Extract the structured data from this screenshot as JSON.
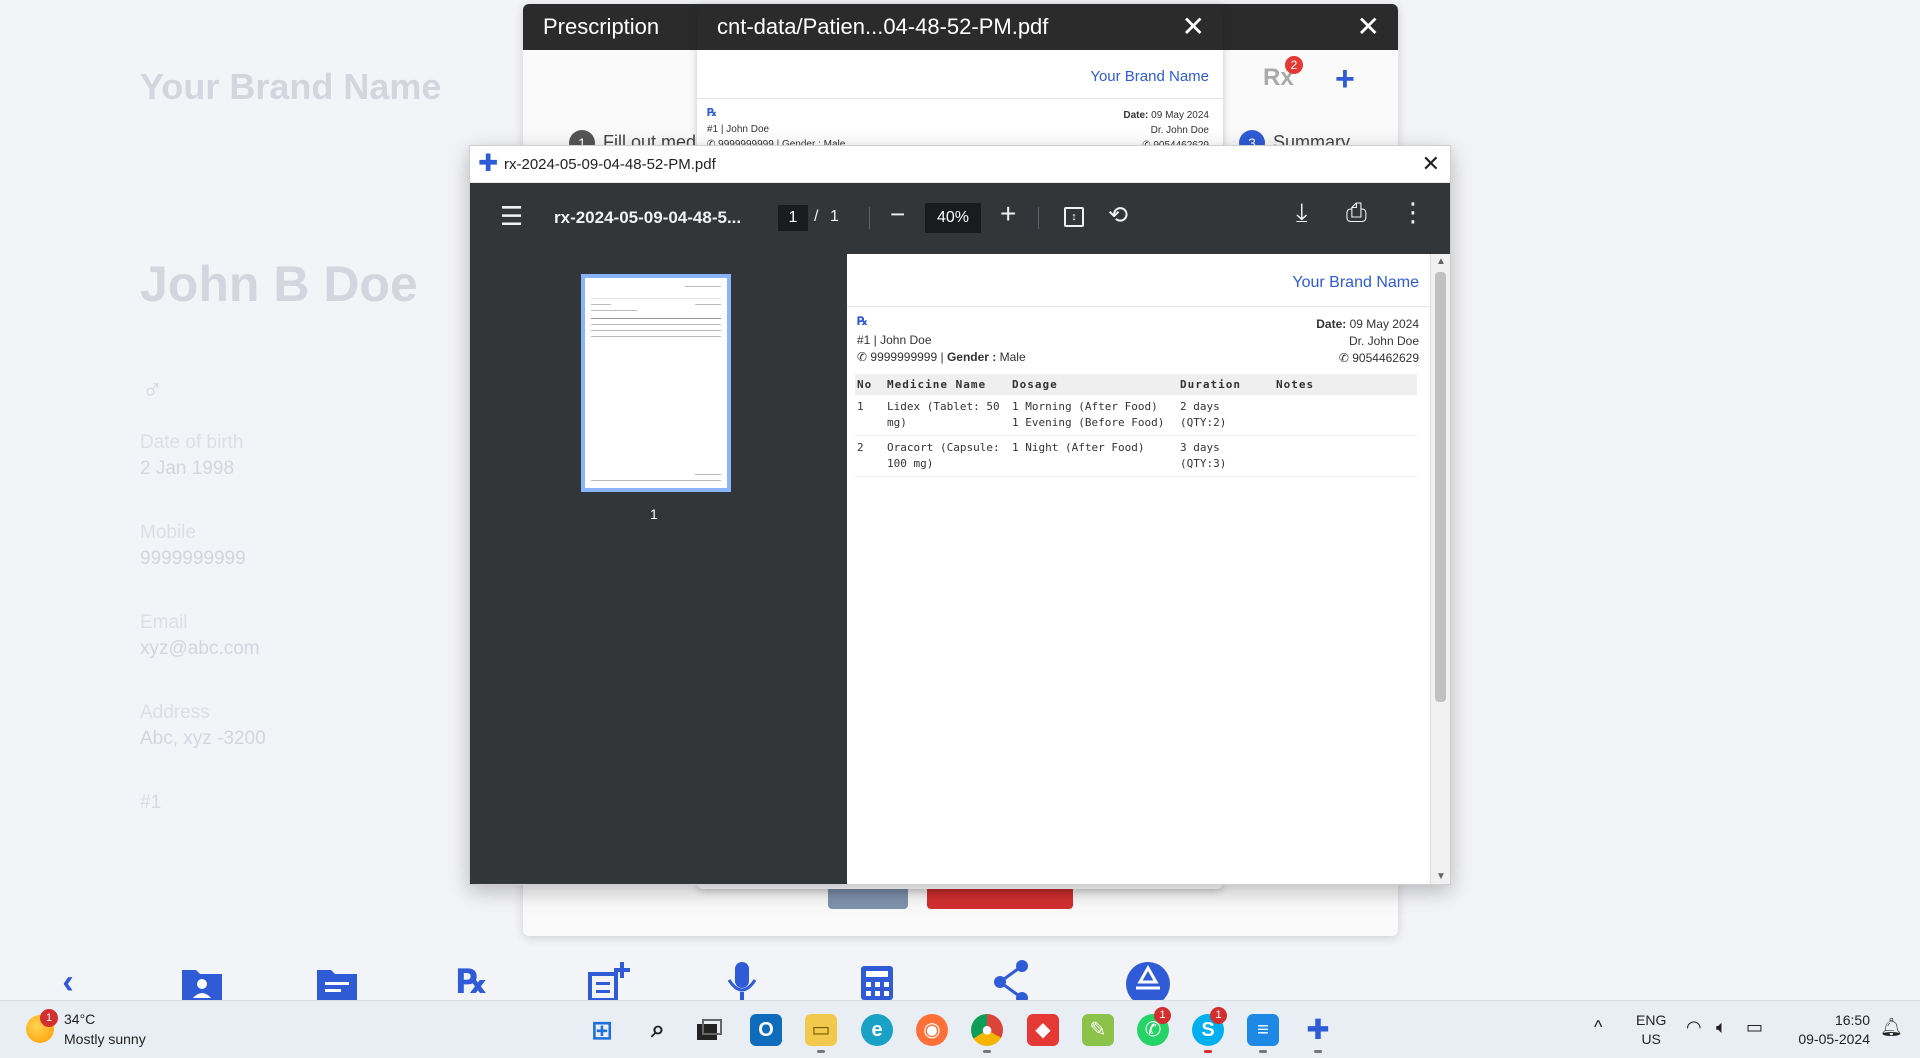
{
  "background": {
    "brand": "Your Brand Name",
    "patient_name": "John B Doe",
    "gender_symbol": "♂",
    "fields": [
      {
        "label": "Date of birth",
        "value": "2 Jan 1998"
      },
      {
        "label": "Mobile",
        "value": "9999999999"
      },
      {
        "label": "Email",
        "value": "xyz@abc.com"
      },
      {
        "label": "Address",
        "value": "Abc, xyz -3200"
      }
    ],
    "patient_id": "#1",
    "bottom_nav_icons": [
      "back-chevron-icon",
      "patient-folder-icon",
      "notes-icon",
      "rx-icon",
      "add-note-icon",
      "microphone-icon",
      "calculator-icon",
      "share-icon",
      "camera-shutter-icon"
    ]
  },
  "prescription_modal": {
    "title": "Prescription",
    "close": "✕",
    "rx_label": "Rx",
    "rx_badge": "2",
    "add": "+",
    "step1_num": "1",
    "step1_label": "Fill out med",
    "step3_num": "3",
    "step3_label": "Summary"
  },
  "pdf_back": {
    "title": "cnt-data/Patien...04-48-52-PM.pdf",
    "close": "✕",
    "brand": "Your Brand Name",
    "rx": "℞",
    "date_label": "Date:",
    "date_value": "09 May 2024",
    "doctor": "Dr. John Doe",
    "doctor_phone": "9054462629",
    "patient_line": "#1 | John Doe",
    "patient_phone_line": "9999999999 | Gender : Male"
  },
  "viewer": {
    "window_title": "rx-2024-05-09-04-48-52-PM.pdf",
    "window_close": "✕",
    "toolbar": {
      "file_name": "rx-2024-05-09-04-48-5...",
      "page_current": "1",
      "page_sep": "/",
      "page_total": "1",
      "zoom": "40%"
    },
    "thumbnail_label": "1",
    "page": {
      "brand": "Your Brand Name",
      "rx": "℞",
      "patient_line": "#1 | John Doe",
      "phone": "9999999999",
      "gender_label": "Gender :",
      "gender": "Male",
      "date_label": "Date:",
      "date_value": "09 May 2024",
      "doctor": "Dr. John Doe",
      "doctor_phone": "9054462629",
      "table": {
        "headers": [
          "No",
          "Medicine Name",
          "Dosage",
          "Duration",
          "Notes"
        ],
        "rows": [
          {
            "no": "1",
            "medicine_1": "Lidex (Tablet: 50",
            "medicine_2": "mg)",
            "dosage_1": "1 Morning (After Food)",
            "dosage_2": "1 Evening (Before Food)",
            "duration_1": "2 days",
            "duration_2": "(QTY:2)",
            "notes": ""
          },
          {
            "no": "2",
            "medicine_1": "Oracort (Capsule:",
            "medicine_2": "100 mg)",
            "dosage_1": "1 Night (After Food)",
            "dosage_2": "",
            "duration_1": "3 days",
            "duration_2": "(QTY:3)",
            "notes": ""
          }
        ]
      }
    }
  },
  "taskbar": {
    "weather_temp": "34°C",
    "weather_desc": "Mostly sunny",
    "weather_badge": "1",
    "whatsapp_badge": "1",
    "skype_badge": "1",
    "language_1": "ENG",
    "language_2": "US",
    "time": "16:50",
    "date": "09-05-2024"
  }
}
